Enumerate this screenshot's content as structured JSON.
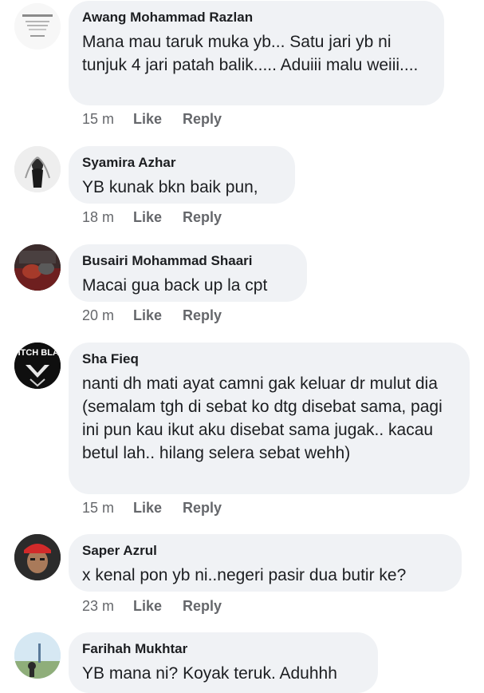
{
  "comments": [
    {
      "name": "Awang Mohammad Razlan",
      "text": "Mana mau taruk muka yb... Satu jari yb ni tunjuk 4 jari patah balik..... Aduiii malu weiii....",
      "time": "15 m",
      "like": "Like",
      "reply": "Reply"
    },
    {
      "name": "Syamira Azhar",
      "text": "YB kunak bkn baik pun,",
      "time": "18 m",
      "like": "Like",
      "reply": "Reply"
    },
    {
      "name": "Busairi Mohammad Shaari",
      "text": "Macai gua back up la cpt",
      "time": "20 m",
      "like": "Like",
      "reply": "Reply"
    },
    {
      "name": "Sha Fieq",
      "text": "nanti dh mati ayat camni gak keluar dr mulut dia (semalam tgh di sebat ko dtg disebat sama, pagi ini pun kau ikut aku disebat sama jugak.. kacau betul lah.. hilang selera sebat wehh)",
      "time": "15 m",
      "like": "Like",
      "reply": "Reply"
    },
    {
      "name": "Saper Azrul",
      "text": "x kenal pon yb ni..negeri pasir dua butir ke?",
      "time": "23 m",
      "like": "Like",
      "reply": "Reply"
    },
    {
      "name": "Farihah Mukhtar",
      "text": "YB mana ni? Koyak teruk. Aduhhh"
    }
  ],
  "avatar_logo_text": "SWITCH BLADE",
  "colors": {
    "bubble": "#f0f2f5",
    "meta": "#65676b",
    "text": "#1c1e21"
  }
}
